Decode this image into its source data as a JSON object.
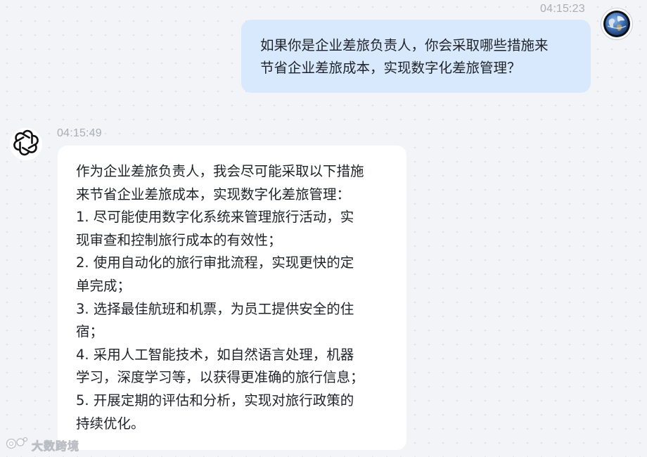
{
  "conversation": {
    "user_message": {
      "timestamp": "04:15:23",
      "text": "如果你是企业差旅负责人，你会采取哪些措施来\n节省企业差旅成本，实现数字化差旅管理？",
      "avatar_icon": "earth-globe-icon"
    },
    "bot_message": {
      "timestamp": "04:15:49",
      "text": "作为企业差旅负责人，我会尽可能采取以下措施\n来节省企业差旅成本，实现数字化差旅管理：\n1. 尽可能使用数字化系统来管理旅行活动，实\n现审查和控制旅行成本的有效性；\n2. 使用自动化的旅行审批流程，实现更快的定\n单完成；\n3. 选择最佳航班和机票，为员工提供安全的住\n宿；\n4. 采用人工智能技术，如自然语言处理，机器\n学习，深度学习等，以获得更准确的旅行信息；\n5. 开展定期的评估和分析，实现对旅行政策的\n持续优化。",
      "avatar_icon": "openai-logo-icon"
    }
  },
  "watermark": {
    "text": "大数跨境",
    "logo_icon": "watermark-logo-icon"
  },
  "colors": {
    "background": "#f2f4f8",
    "user_bubble": "#d9e9fd",
    "bot_bubble": "#ffffff",
    "timestamp": "#a9aeb6"
  }
}
